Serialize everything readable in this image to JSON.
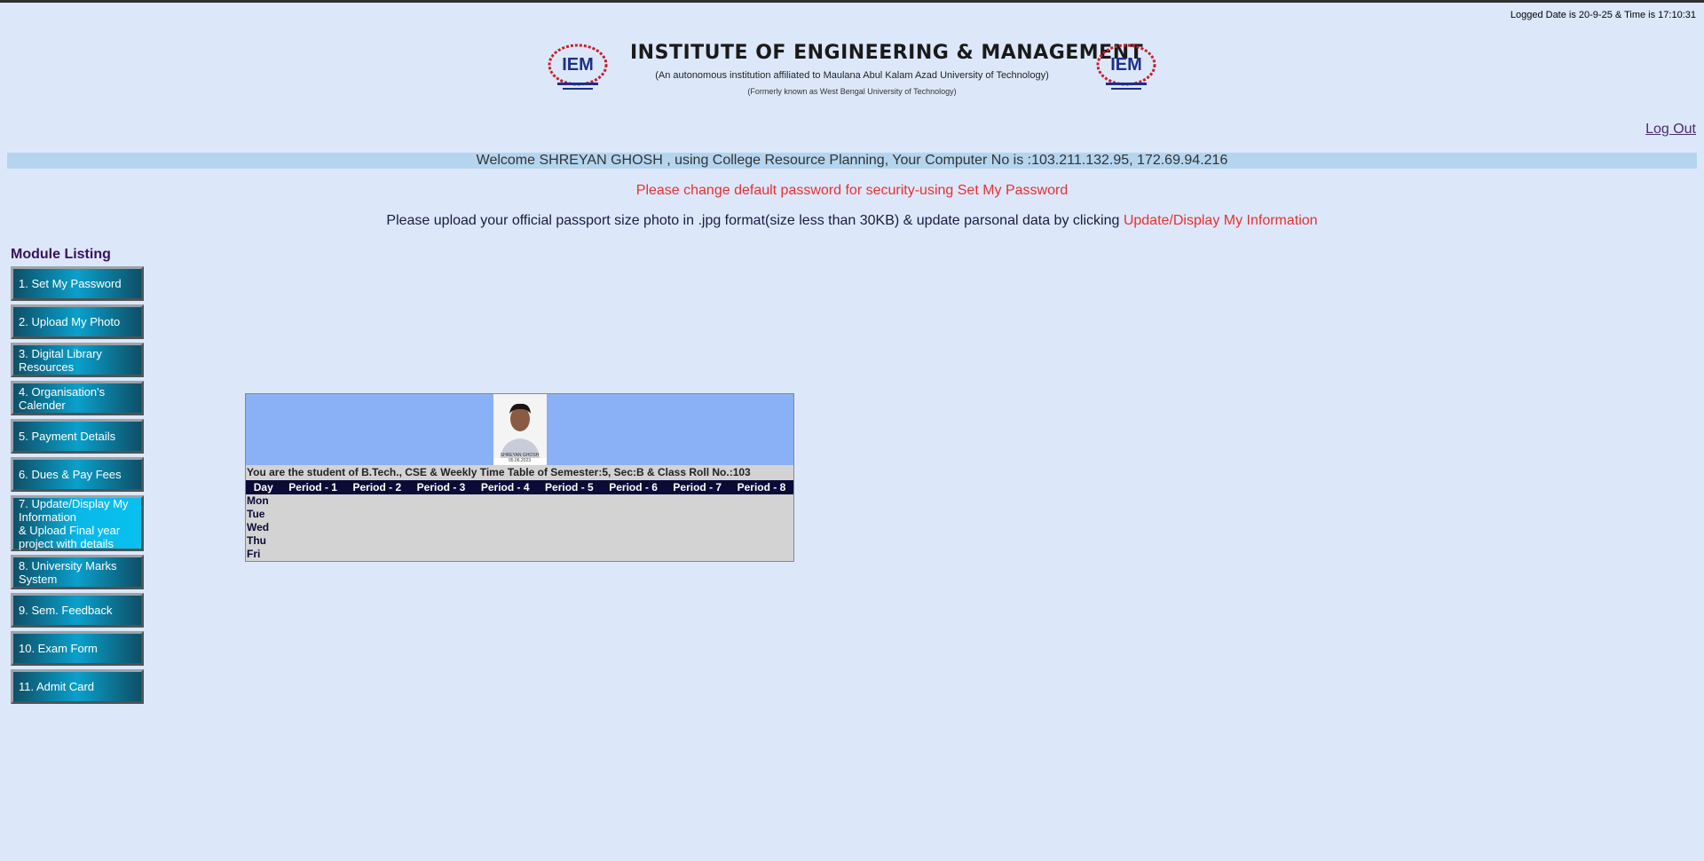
{
  "header": {
    "logged": "Logged Date is 20-9-25 & Time is 17:10:31",
    "institute_title": "INSTITUTE OF ENGINEERING & MANAGEMENT",
    "institute_sub1": "(An autonomous institution affiliated to Maulana Abul Kalam Azad University of Technology)",
    "institute_sub2": "(Formerly known as West Bengal University of Technology)",
    "logo_text": "IEM"
  },
  "logout_label": "Log Out",
  "welcome": "Welcome SHREYAN GHOSH , using College Resource Planning, Your Computer No is :103.211.132.95, 172.69.94.216",
  "password_msg": "Please change default password for security-using Set My Password",
  "upload_msg": {
    "text": "Please upload your official passport size photo in .jpg format(size less than 30KB) & update parsonal data by clicking ",
    "link": "Update/Display My Information"
  },
  "module_title": "Module Listing",
  "menu": [
    "1. Set My Password",
    "2. Upload My Photo",
    "3. Digital Library Resources",
    "4. Organisation's Calender",
    "5. Payment Details",
    "6. Dues & Pay Fees",
    "7. Update/Display My Information",
    "& Upload Final year project with details",
    "8. University Marks System",
    "9. Sem. Feedback",
    "10. Exam Form",
    "11. Admit Card"
  ],
  "timetable": {
    "photo_caption_1": "SHREYAN GHOSH",
    "photo_caption_2": "05.06.2023",
    "caption": "You are the student of B.Tech., CSE & Weekly Time Table of Semester:5, Sec:B & Class Roll No.:103",
    "headers": [
      "Day",
      "Period - 1",
      "Period - 2",
      "Period - 3",
      "Period - 4",
      "Period - 5",
      "Period - 6",
      "Period - 7",
      "Period - 8"
    ],
    "days": [
      "Mon",
      "Tue",
      "Wed",
      "Thu",
      "Fri"
    ]
  },
  "colors": {
    "background": "#dce8fa",
    "welcome_bar": "#b5d5ef",
    "alert": "#e83030",
    "menu_button": "#0aa0cc",
    "table_header": "#0b0b38",
    "photo_row": "#8ab0f5"
  }
}
